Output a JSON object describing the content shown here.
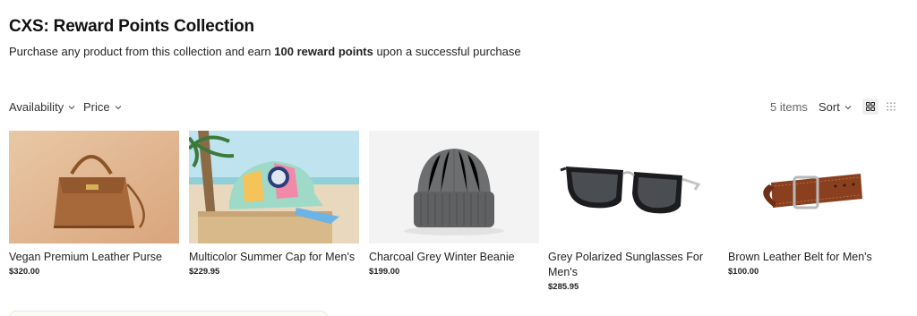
{
  "header": {
    "title": "CXS: Reward Points Collection",
    "subtitle_pre": "Purchase any product from this collection and earn ",
    "subtitle_bold": "100 reward points",
    "subtitle_post": " upon a successful purchase"
  },
  "toolbar": {
    "filters": [
      {
        "label": "Availability"
      },
      {
        "label": "Price"
      }
    ],
    "items_count": "5 items",
    "sort_label": "Sort",
    "views": [
      "grid-large-icon",
      "grid-small-icon"
    ],
    "active_view": "grid-large-icon"
  },
  "products": [
    {
      "name": "Vegan Premium Leather Purse",
      "price": "$320.00",
      "image": "leather-purse"
    },
    {
      "name": "Multicolor Summer Cap for Men's",
      "price": "$229.95",
      "image": "summer-cap"
    },
    {
      "name": "Charcoal Grey Winter Beanie",
      "price": "$199.00",
      "image": "beanie"
    },
    {
      "name": "Grey Polarized Sunglasses For Men's",
      "price": "$285.95",
      "image": "sunglasses"
    },
    {
      "name": "Brown Leather Belt for Men's",
      "price": "$100.00",
      "image": "belt"
    }
  ],
  "colors": {
    "text": "#111111",
    "muted": "#666666",
    "active_view_bg": "#eeeeee"
  }
}
